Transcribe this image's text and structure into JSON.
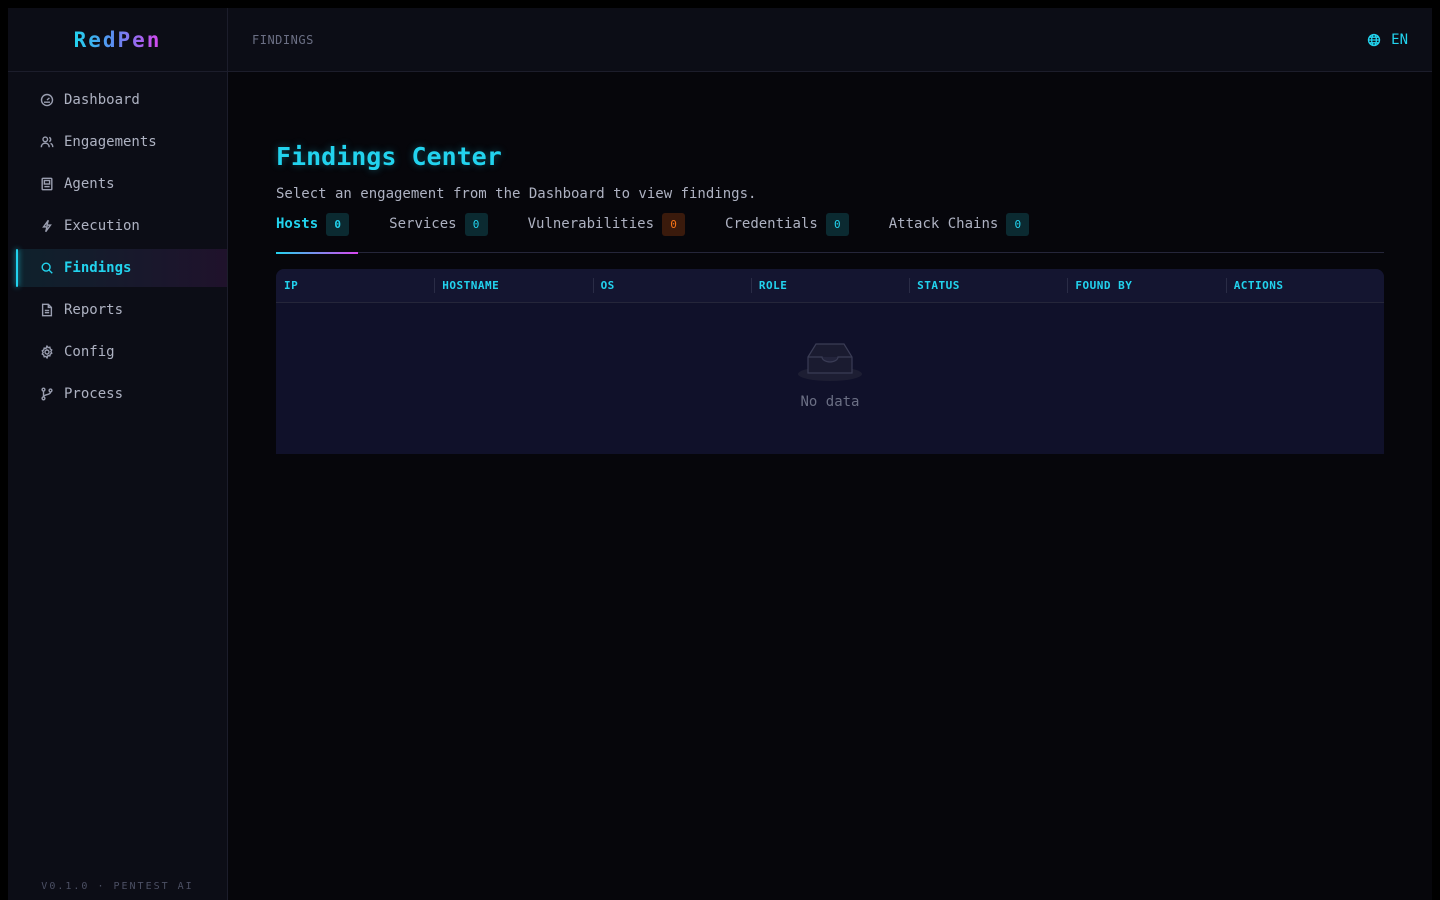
{
  "brand": {
    "name": "RedPen"
  },
  "sidebar": {
    "items": [
      {
        "label": "Dashboard",
        "icon": "dashboard-icon"
      },
      {
        "label": "Engagements",
        "icon": "users-icon"
      },
      {
        "label": "Agents",
        "icon": "agent-icon"
      },
      {
        "label": "Execution",
        "icon": "lightning-icon"
      },
      {
        "label": "Findings",
        "icon": "search-icon",
        "active": true
      },
      {
        "label": "Reports",
        "icon": "document-icon"
      },
      {
        "label": "Config",
        "icon": "gear-icon"
      },
      {
        "label": "Process",
        "icon": "branch-icon"
      }
    ],
    "version": "V0.1.0 · PENTEST AI"
  },
  "header": {
    "breadcrumb": "FINDINGS",
    "language": "EN"
  },
  "main": {
    "title": "Findings Center",
    "subtitle": "Select an engagement from the Dashboard to view findings.",
    "tabs": [
      {
        "label": "Hosts",
        "count": "0",
        "active": true
      },
      {
        "label": "Services",
        "count": "0"
      },
      {
        "label": "Vulnerabilities",
        "count": "0",
        "status": "warning"
      },
      {
        "label": "Credentials",
        "count": "0"
      },
      {
        "label": "Attack Chains",
        "count": "0"
      }
    ],
    "table": {
      "columns": [
        "IP",
        "HOSTNAME",
        "OS",
        "ROLE",
        "STATUS",
        "FOUND BY",
        "ACTIONS"
      ],
      "rows": [],
      "empty_text": "No data"
    }
  },
  "colors": {
    "accent": "#22d3ee",
    "accent_secondary": "#d946ef",
    "warning": "#f97316",
    "background": "#06060b"
  }
}
